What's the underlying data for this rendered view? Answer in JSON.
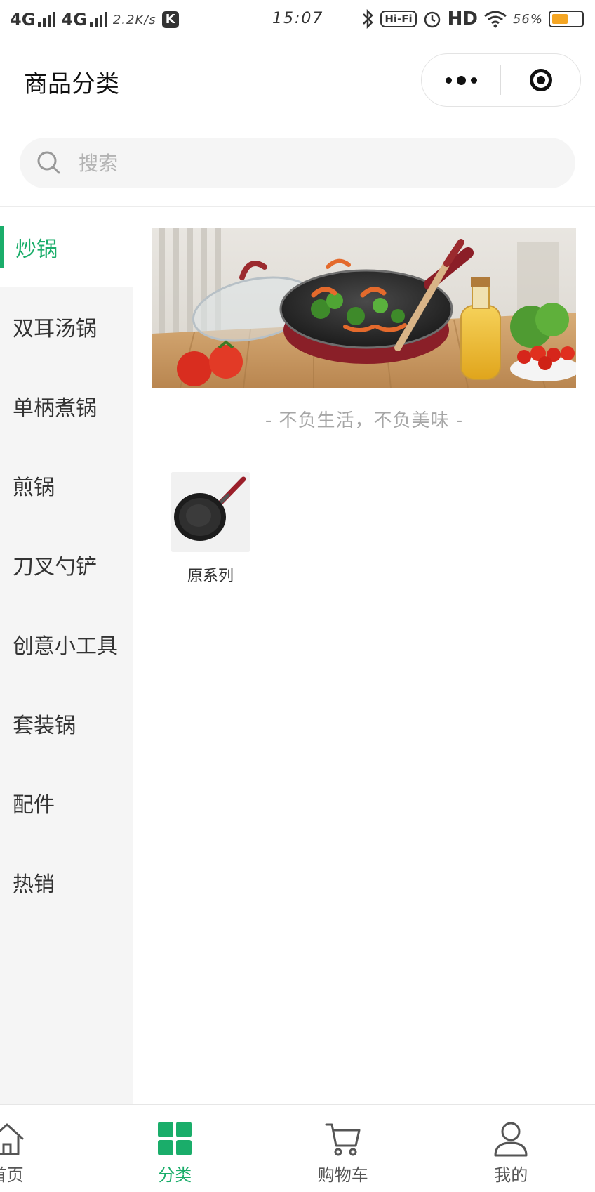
{
  "status_bar": {
    "network1": "4G",
    "network2": "4G",
    "speed": "2.2K/s",
    "app_badge": "K",
    "time": "15:07",
    "hifi": "Hi-Fi",
    "hd": "HD",
    "battery": "56%"
  },
  "header": {
    "title": "商品分类"
  },
  "search": {
    "placeholder": "搜索"
  },
  "sidebar": {
    "items": [
      {
        "label": "炒锅",
        "active": true
      },
      {
        "label": "双耳汤锅"
      },
      {
        "label": "单柄煮锅"
      },
      {
        "label": "煎锅"
      },
      {
        "label": "刀叉勺铲"
      },
      {
        "label": "创意小工具"
      },
      {
        "label": "套装锅"
      },
      {
        "label": "配件"
      },
      {
        "label": "热销"
      }
    ]
  },
  "main": {
    "slogan": "- 不负生活，不负美味 -",
    "products": [
      {
        "name": "原系列"
      }
    ]
  },
  "tabbar": {
    "tabs": [
      {
        "label": "首页",
        "icon": "home-icon"
      },
      {
        "label": "分类",
        "icon": "category-grid-icon",
        "active": true
      },
      {
        "label": "购物车",
        "icon": "cart-icon"
      },
      {
        "label": "我的",
        "icon": "user-icon"
      }
    ]
  },
  "colors": {
    "accent": "#1aad6a",
    "sidebar_bg": "#f5f5f5",
    "muted_text": "#a6a6a6"
  }
}
